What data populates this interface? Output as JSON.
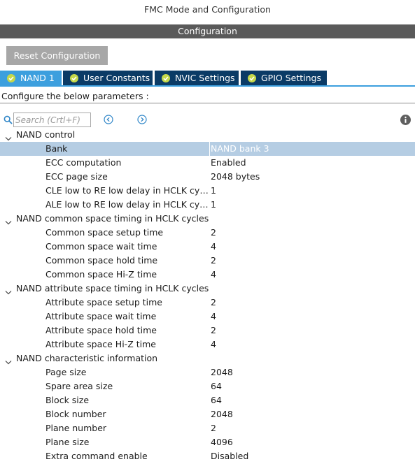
{
  "header": {
    "mode_title": "FMC Mode and Configuration",
    "config_title": "Configuration"
  },
  "toolbar": {
    "reset_label": "Reset Configuration"
  },
  "tabs": [
    {
      "label": "NAND 1",
      "active": true
    },
    {
      "label": "User Constants",
      "active": false
    },
    {
      "label": "NVIC Settings",
      "active": false
    },
    {
      "label": "GPIO Settings",
      "active": false
    }
  ],
  "hint": "Configure the below parameters :",
  "search": {
    "placeholder": "Search (Crtl+F)"
  },
  "colors": {
    "tab_active": "#3c9fde",
    "tab_inactive": "#0b3b66",
    "check": "#c5d84a",
    "selected_row": "#b5cde3"
  },
  "groups": [
    {
      "label": "NAND control",
      "rows": [
        {
          "name": "Bank",
          "value": "NAND bank 3",
          "selected": true
        },
        {
          "name": "ECC computation",
          "value": "Enabled"
        },
        {
          "name": "ECC page size",
          "value": "2048 bytes"
        },
        {
          "name": "CLE low to RE low delay in HCLK cycles",
          "value": "1"
        },
        {
          "name": "ALE low to RE low delay in HCLK cycles",
          "value": "1"
        }
      ]
    },
    {
      "label": "NAND common space timing in HCLK cycles",
      "rows": [
        {
          "name": "Common space setup time",
          "value": "2"
        },
        {
          "name": "Common space wait time",
          "value": "4"
        },
        {
          "name": "Common space hold time",
          "value": "2"
        },
        {
          "name": "Common space Hi-Z time",
          "value": "4"
        }
      ]
    },
    {
      "label": "NAND attribute space timing in HCLK cycles",
      "rows": [
        {
          "name": "Attribute space setup time",
          "value": "2"
        },
        {
          "name": "Attribute space wait time",
          "value": "4"
        },
        {
          "name": "Attribute space hold time",
          "value": "2"
        },
        {
          "name": "Attribute space Hi-Z time",
          "value": "4"
        }
      ]
    },
    {
      "label": "NAND characteristic information",
      "rows": [
        {
          "name": "Page size",
          "value": "2048"
        },
        {
          "name": "Spare area size",
          "value": "64"
        },
        {
          "name": "Block size",
          "value": "64"
        },
        {
          "name": "Block number",
          "value": "2048"
        },
        {
          "name": "Plane number",
          "value": "2"
        },
        {
          "name": "Plane size",
          "value": "4096"
        },
        {
          "name": "Extra command enable",
          "value": "Disabled"
        }
      ]
    }
  ]
}
